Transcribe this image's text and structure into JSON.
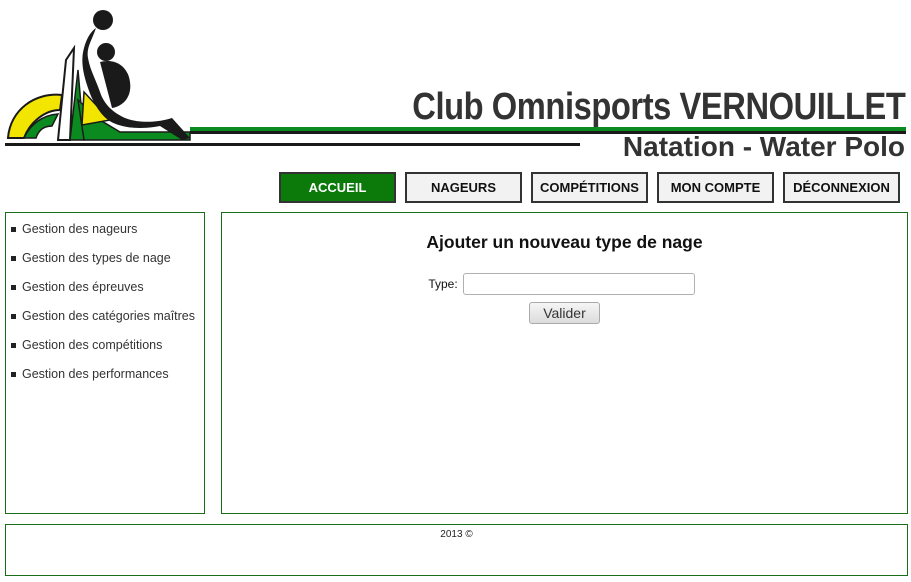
{
  "header": {
    "club_name": "Club Omnisports  VERNOUILLET",
    "subtitle": "Natation - Water Polo",
    "colors": {
      "green": "#0b8a1f",
      "yellow": "#f2e600",
      "dark": "#1a1a1a"
    }
  },
  "nav": {
    "items": [
      {
        "label": "ACCUEIL",
        "active": true
      },
      {
        "label": "NAGEURS"
      },
      {
        "label": "COMPÉTITIONS"
      },
      {
        "label": "MON COMPTE"
      },
      {
        "label": "DÉCONNEXION"
      }
    ]
  },
  "sidebar": {
    "items": [
      {
        "label": "Gestion des nageurs"
      },
      {
        "label": "Gestion des types de nage"
      },
      {
        "label": "Gestion des épreuves"
      },
      {
        "label": "Gestion des catégories maîtres"
      },
      {
        "label": "Gestion des compétitions"
      },
      {
        "label": "Gestion des performances"
      }
    ]
  },
  "main": {
    "title": "Ajouter un nouveau type de nage",
    "form": {
      "type_label": "Type:",
      "type_value": "",
      "submit_label": "Valider"
    }
  },
  "footer": {
    "text": "2013 ©"
  }
}
